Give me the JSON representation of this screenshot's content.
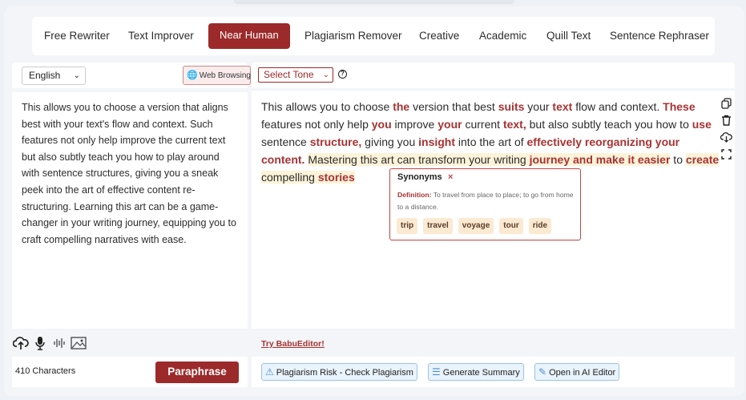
{
  "tabs": [
    {
      "label": "Free Rewriter"
    },
    {
      "label": "Text Improver"
    },
    {
      "label": "Near Human"
    },
    {
      "label": "Plagiarism Remover"
    },
    {
      "label": "Creative"
    },
    {
      "label": "Academic"
    },
    {
      "label": "Quill Text"
    },
    {
      "label": "Sentence Rephraser"
    }
  ],
  "active_tab": "Near Human",
  "left": {
    "language": "English",
    "web_browsing": "Web Browsing",
    "input_text": "This allows you to choose a version that aligns best with your text's flow and context. Such features not only help improve the current text but also subtly teach you how to play around with sentence structures, giving you a sneak peek into the art of effective content re-structuring. Learning this art can be a game-changer in your writing journey, equipping you to craft compelling narratives with ease.",
    "char_count": "410 Characters",
    "paraphrase_label": "Paraphrase"
  },
  "right": {
    "tone_placeholder": "Select Tone",
    "output_segments": [
      {
        "t": "This allows you to choose ",
        "s": ""
      },
      {
        "t": "the",
        "s": "c"
      },
      {
        "t": " version that best ",
        "s": ""
      },
      {
        "t": "suits",
        "s": "c"
      },
      {
        "t": " your ",
        "s": ""
      },
      {
        "t": "text",
        "s": "c"
      },
      {
        "t": " flow and context. ",
        "s": ""
      },
      {
        "t": "These",
        "s": "c"
      },
      {
        "t": " features not only help ",
        "s": ""
      },
      {
        "t": "you",
        "s": "c"
      },
      {
        "t": " improve ",
        "s": ""
      },
      {
        "t": "your",
        "s": "c"
      },
      {
        "t": " current ",
        "s": ""
      },
      {
        "t": "text,",
        "s": "c"
      },
      {
        "t": " but also subtly teach you how to ",
        "s": ""
      },
      {
        "t": "use",
        "s": "c"
      },
      {
        "t": " sentence ",
        "s": ""
      },
      {
        "t": "structure,",
        "s": "c"
      },
      {
        "t": " giving you ",
        "s": ""
      },
      {
        "t": "insight",
        "s": "c"
      },
      {
        "t": " into the art of ",
        "s": ""
      },
      {
        "t": "effectively reorganizing your content.",
        "s": "c"
      },
      {
        "t": " ",
        "s": ""
      },
      {
        "t": "Mastering this art can transform your writing ",
        "s": "hl"
      },
      {
        "t": "journey and make it easier",
        "s": "c hl"
      },
      {
        "t": " to ",
        "s": ""
      },
      {
        "t": "create",
        "s": "c hl"
      },
      {
        "t": " compelling ",
        "s": "hl"
      },
      {
        "t": "stories",
        "s": "c hl"
      }
    ],
    "synonyms": {
      "title": "Synonyms",
      "close": "×",
      "definition_label": "Definition:",
      "definition_text": "To travel from place to place; to go from home to a distance.",
      "chips": [
        "trip",
        "travel",
        "voyage",
        "tour",
        "ride"
      ]
    },
    "try_link": "Try BabuEditor!",
    "actions": [
      {
        "label": "Plagiarism Risk - Check Plagiarism",
        "icon": "warning-icon"
      },
      {
        "label": "Generate Summary",
        "icon": "summary-icon"
      },
      {
        "label": "Open in AI Editor",
        "icon": "editor-icon"
      }
    ]
  },
  "colors": {
    "accent": "#9c2a2a",
    "changed_word": "#a83232",
    "highlight": "#fdf3d9",
    "action_button_bg": "#e9f3fc"
  }
}
